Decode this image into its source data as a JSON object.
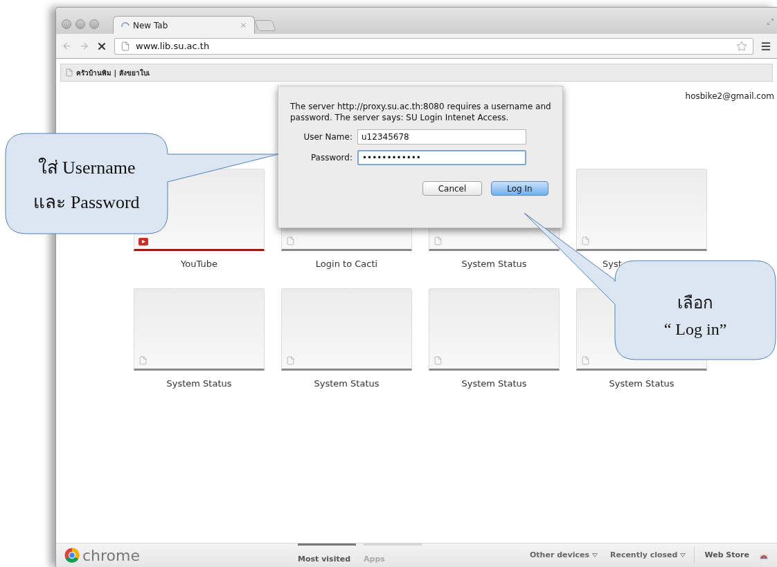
{
  "window": {
    "tabs": [
      {
        "title": "New Tab",
        "loading": true,
        "selected": true
      }
    ]
  },
  "toolbar": {
    "address": "www.lib.su.ac.th"
  },
  "bookmarks": [
    {
      "label": "ครัวบ้านพิม | สังขยาใบเ"
    }
  ],
  "account": "hosbike2@gmail.com",
  "tiles": [
    {
      "title": "YouTube",
      "kind": "youtube"
    },
    {
      "title": "Login to Cacti",
      "kind": "page"
    },
    {
      "title": "System Status",
      "kind": "page"
    },
    {
      "title": "Syst",
      "kind": "page",
      "partly_covered": true
    },
    {
      "title": "System Status",
      "kind": "page"
    },
    {
      "title": "System Status",
      "kind": "page"
    },
    {
      "title": "System Status",
      "kind": "page"
    },
    {
      "title": "System Status",
      "kind": "page"
    }
  ],
  "footer": {
    "logo_text": "chrome",
    "tabs": [
      {
        "label": "Most visited",
        "selected": true
      },
      {
        "label": "Apps",
        "selected": false
      }
    ],
    "links": [
      {
        "label": "Other devices",
        "menu": true
      },
      {
        "label": "Recently closed",
        "menu": true
      }
    ],
    "web_store": "Web Store"
  },
  "dialog": {
    "message": "The server http://proxy.su.ac.th:8080 requires a username and password. The server says: SU Login Intenet Access.",
    "fields": [
      {
        "label": "User Name:",
        "value": "u12345678",
        "focused": false
      },
      {
        "label": "Password:",
        "value": "••••••••••••",
        "focused": true
      }
    ],
    "buttons": [
      {
        "label": "Cancel",
        "default": false
      },
      {
        "label": "Log In",
        "default": true
      }
    ]
  },
  "callouts": [
    {
      "lines": [
        "ใส่ Username",
        "และ Password"
      ]
    },
    {
      "lines": [
        "เลือก",
        "“ Log in”"
      ]
    }
  ]
}
